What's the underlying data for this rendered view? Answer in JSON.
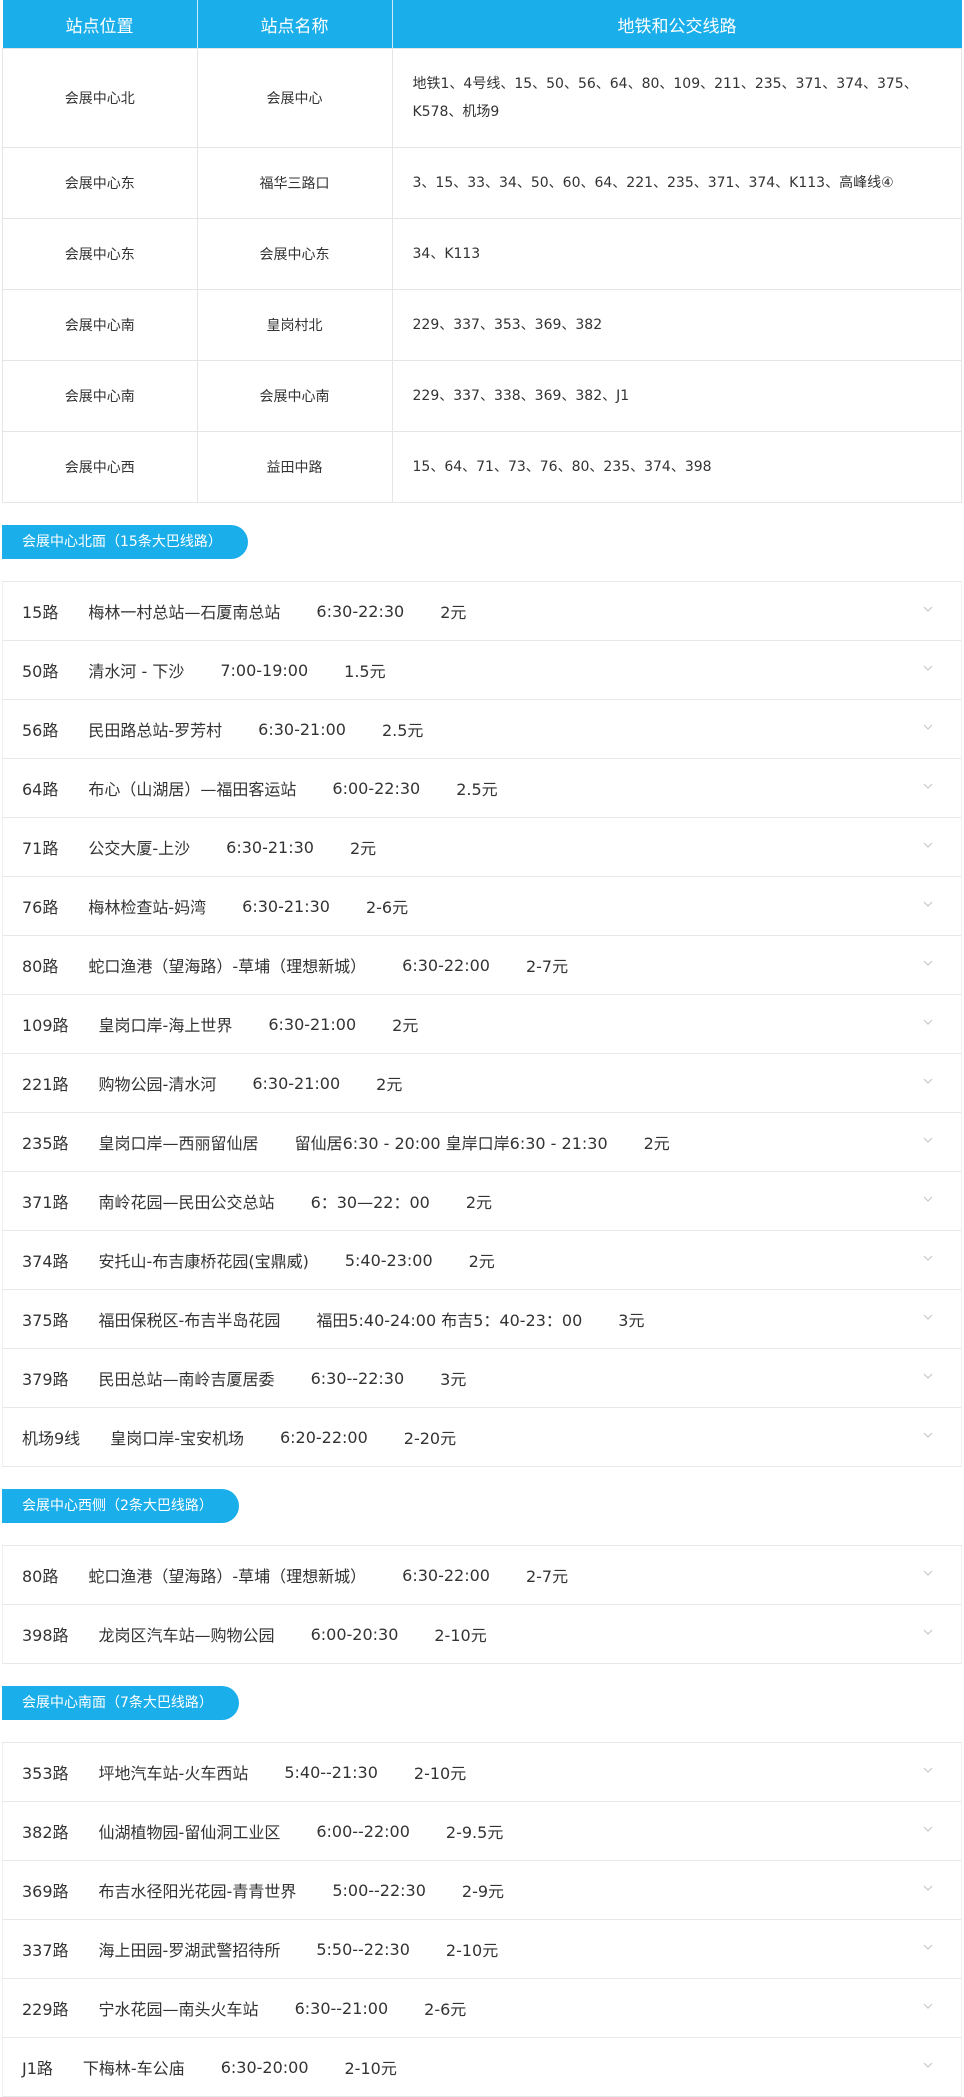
{
  "table": {
    "headers": [
      "站点位置",
      "站点名称",
      "地铁和公交线路"
    ],
    "rows": [
      {
        "pos": "会展中心北",
        "name": "会展中心",
        "lines": "地铁1、4号线、15、50、56、64、80、109、211、235、371、374、375、K578、机场9"
      },
      {
        "pos": "会展中心东",
        "name": "福华三路口",
        "lines": "3、15、33、34、50、60、64、221、235、371、374、K113、高峰线④"
      },
      {
        "pos": "会展中心东",
        "name": "会展中心东",
        "lines": "34、K113"
      },
      {
        "pos": "会展中心南",
        "name": "皇岗村北",
        "lines": "229、337、353、369、382"
      },
      {
        "pos": "会展中心南",
        "name": "会展中心南",
        "lines": "229、337、338、369、382、J1"
      },
      {
        "pos": "会展中心西",
        "name": "益田中路",
        "lines": "15、64、71、73、76、80、235、374、398"
      }
    ]
  },
  "sections": [
    {
      "label": "会展中心北面（15条大巴线路）",
      "routes": [
        {
          "no": "15路",
          "route": "梅林一村总站—石厦南总站",
          "time": "6:30-22:30",
          "fare": "2元"
        },
        {
          "no": "50路",
          "route": "清水河 - 下沙",
          "time": "7:00-19:00",
          "fare": "1.5元"
        },
        {
          "no": "56路",
          "route": "民田路总站-罗芳村",
          "time": "6:30-21:00",
          "fare": "2.5元"
        },
        {
          "no": "64路",
          "route": "布心（山湖居）—福田客运站",
          "time": "6:00-22:30",
          "fare": "2.5元"
        },
        {
          "no": "71路",
          "route": "公交大厦-上沙",
          "time": "6:30-21:30",
          "fare": "2元"
        },
        {
          "no": "76路",
          "route": "梅林检查站-妈湾",
          "time": "6:30-21:30",
          "fare": "2-6元"
        },
        {
          "no": "80路",
          "route": "蛇口渔港（望海路）-草埔（理想新城）",
          "time": "6:30-22:00",
          "fare": "2-7元"
        },
        {
          "no": "109路",
          "route": "皇岗口岸-海上世界",
          "time": "6:30-21:00",
          "fare": "2元"
        },
        {
          "no": "221路",
          "route": "购物公园-清水河",
          "time": "6:30-21:00",
          "fare": "2元"
        },
        {
          "no": "235路",
          "route": "皇岗口岸—西丽留仙居",
          "time": "留仙居6:30 - 20:00 皇岸口岸6:30 - 21:30",
          "fare": "2元"
        },
        {
          "no": "371路",
          "route": "南岭花园—民田公交总站",
          "time": "6：30—22：00",
          "fare": "2元"
        },
        {
          "no": "374路",
          "route": "安托山-布吉康桥花园(宝鼎威)",
          "time": "5:40-23:00",
          "fare": "2元"
        },
        {
          "no": "375路",
          "route": "福田保税区-布吉半岛花园",
          "time": "福田5:40-24:00 布吉5：40-23：00",
          "fare": "3元"
        },
        {
          "no": "379路",
          "route": "民田总站—南岭吉厦居委",
          "time": "6:30--22:30",
          "fare": "3元"
        },
        {
          "no": "机场9线",
          "route": "皇岗口岸-宝安机场",
          "time": "6:20-22:00",
          "fare": "2-20元"
        }
      ]
    },
    {
      "label": "会展中心西侧（2条大巴线路）",
      "routes": [
        {
          "no": "80路",
          "route": "蛇口渔港（望海路）-草埔（理想新城）",
          "time": "6:30-22:00",
          "fare": "2-7元"
        },
        {
          "no": "398路",
          "route": "龙岗区汽车站—购物公园",
          "time": "6:00-20:30",
          "fare": "2-10元"
        }
      ]
    },
    {
      "label": "会展中心南面（7条大巴线路）",
      "routes": [
        {
          "no": "353路",
          "route": "坪地汽车站-火车西站",
          "time": "5:40--21:30",
          "fare": "2-10元"
        },
        {
          "no": "382路",
          "route": "仙湖植物园-留仙洞工业区",
          "time": "6:00--22:00",
          "fare": "2-9.5元"
        },
        {
          "no": "369路",
          "route": "布吉水径阳光花园-青青世界",
          "time": "5:00--22:30",
          "fare": "2-9元"
        },
        {
          "no": "337路",
          "route": "海上田园-罗湖武警招待所",
          "time": "5:50--22:30",
          "fare": "2-10元"
        },
        {
          "no": "229路",
          "route": "宁水花园—南头火车站",
          "time": "6:30--21:00",
          "fare": "2-6元"
        },
        {
          "no": "J1路",
          "route": "下梅林-车公庙",
          "time": "6:30-20:00",
          "fare": "2-10元"
        }
      ]
    }
  ],
  "colors": {
    "accent": "#1aaeea",
    "chevron": "#c8c8c8"
  },
  "icons": {
    "row_toggle": "chevron-down-icon"
  }
}
